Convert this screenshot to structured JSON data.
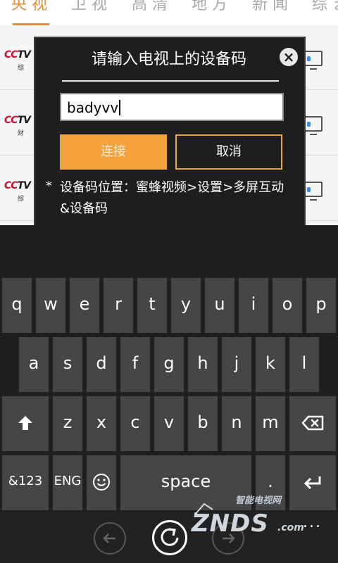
{
  "tabs": [
    {
      "label": "央视"
    },
    {
      "label": "卫视"
    },
    {
      "label": "高清"
    },
    {
      "label": "地方"
    },
    {
      "label": "新闻"
    },
    {
      "label": "综艺"
    }
  ],
  "channels": [
    {
      "logo": "CCTV",
      "sub": "综"
    },
    {
      "logo": "CCTV",
      "sub": "财"
    },
    {
      "logo": "CCTV",
      "sub": "综"
    }
  ],
  "dialog": {
    "title": "请输入电视上的设备码",
    "input_value": "badyvv",
    "connect_label": "连接",
    "cancel_label": "取消",
    "hint_star": "*",
    "hint": "设备码位置：蜜蜂视频>设置>多屏互动&设备码"
  },
  "keyboard": {
    "row1": [
      "q",
      "w",
      "e",
      "r",
      "t",
      "y",
      "u",
      "i",
      "o",
      "p"
    ],
    "row2": [
      "a",
      "s",
      "d",
      "f",
      "g",
      "h",
      "j",
      "k",
      "l"
    ],
    "row3": [
      "z",
      "x",
      "c",
      "v",
      "b",
      "n",
      "m"
    ],
    "symbols_label": "&123",
    "lang_label": "ENG",
    "space_label": "space",
    "period_label": "."
  },
  "watermark": {
    "cn": "智能电视网",
    "main": "ZNDS",
    "domain": ".com"
  },
  "more_label": "...",
  "colors": {
    "accent": "#f4a23c",
    "tab_active": "#e08f3b",
    "key": "#464646",
    "keyboard_bg": "#1f1f1f",
    "dialog_bg": "#1e1e1e"
  },
  "icons": {
    "close": "close-icon",
    "shift": "shift-arrow-icon",
    "backspace": "backspace-icon",
    "emoji": "smiley-icon",
    "enter": "enter-icon",
    "back": "back-arrow-icon",
    "refresh": "refresh-icon",
    "forward": "forward-arrow-icon",
    "tv": "tv-icon"
  }
}
